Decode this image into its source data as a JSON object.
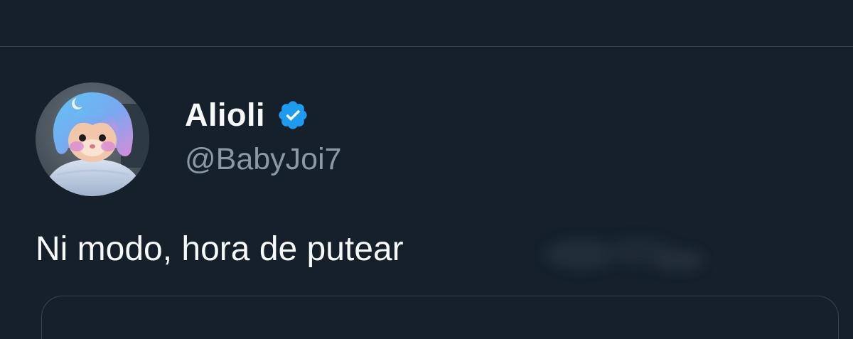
{
  "tweet": {
    "author": {
      "display_name": "Alioli",
      "handle": "@BabyJoi7",
      "verified_icon": "verified-badge-icon",
      "avatar_icon": "cat-with-blue-hair-avatar"
    },
    "text": "Ni modo, hora de putear"
  },
  "colors": {
    "background": "#15202b",
    "divider": "#38444d",
    "primary_text": "#f7f9f9",
    "secondary_text": "#8b98a5",
    "verified_blue": "#1d9bf0"
  }
}
